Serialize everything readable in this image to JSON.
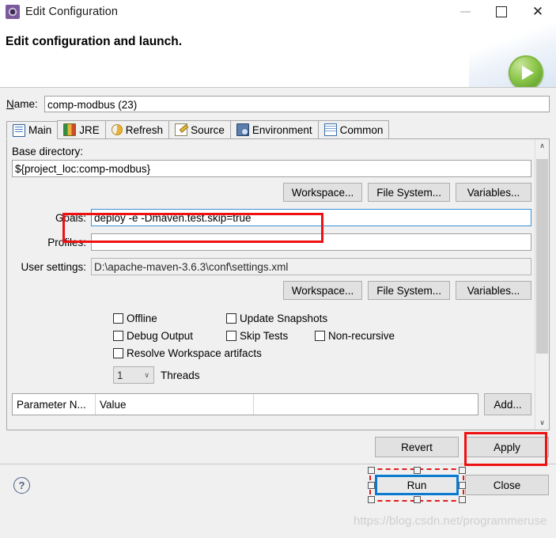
{
  "window": {
    "title": "Edit Configuration",
    "icon": "gear-icon",
    "controls": {
      "minimize": "—",
      "maximize": "□",
      "close": "✕"
    }
  },
  "header": {
    "title": "Edit configuration and launch.",
    "badge_icon": "green-run-play-icon"
  },
  "name_field": {
    "label": "Name:",
    "value": "comp-modbus (23)"
  },
  "tabs": [
    {
      "label": "Main",
      "icon": "main-document-icon",
      "active": true
    },
    {
      "label": "JRE",
      "icon": "jre-books-icon",
      "active": false
    },
    {
      "label": "Refresh",
      "icon": "refresh-arrows-icon",
      "active": false
    },
    {
      "label": "Source",
      "icon": "source-pencil-icon",
      "active": false
    },
    {
      "label": "Environment",
      "icon": "environment-monitor-icon",
      "active": false
    },
    {
      "label": "Common",
      "icon": "common-window-icon",
      "active": false
    }
  ],
  "main_tab": {
    "base_directory": {
      "label": "Base directory:",
      "value": "${project_loc:comp-modbus}"
    },
    "browse_buttons_top": [
      "Workspace...",
      "File System...",
      "Variables..."
    ],
    "goals": {
      "label": "Goals:",
      "value": "deploy -e -Dmaven.test.skip=true",
      "focused": true,
      "highlighted": true
    },
    "profiles": {
      "label": "Profiles:",
      "value": ""
    },
    "user_settings": {
      "label": "User settings:",
      "value": "D:\\apache-maven-3.6.3\\conf\\settings.xml"
    },
    "browse_buttons_bottom": [
      "Workspace...",
      "File System...",
      "Variables..."
    ],
    "checkboxes": [
      {
        "label": "Offline",
        "checked": false
      },
      {
        "label": "Update Snapshots",
        "checked": false
      },
      {
        "label": "Debug Output",
        "checked": false
      },
      {
        "label": "Skip Tests",
        "checked": false
      },
      {
        "label": "Non-recursive",
        "checked": false
      },
      {
        "label": "Resolve Workspace artifacts",
        "checked": false
      }
    ],
    "threads": {
      "value": "1",
      "label": "Threads",
      "caret": "∨"
    },
    "parameter_table": {
      "columns": [
        "Parameter N...",
        "Value",
        ""
      ],
      "rows": []
    },
    "add_button": "Add...",
    "scrollbar": {
      "up": "∧",
      "down": "∨"
    }
  },
  "footer": {
    "revert_button": "Revert",
    "apply_button": "Apply",
    "apply_highlighted": true,
    "help_icon": "help-question-icon",
    "run_button": "Run",
    "run_focused": true,
    "close_button": "Close"
  },
  "watermark": "https://blog.csdn.net/programmeruse",
  "colors": {
    "annotation_red": "#ee1111",
    "focus_blue": "#0a7bd0",
    "dialog_bg": "#f0f0f0",
    "run_badge_green": "#8cc64a"
  }
}
